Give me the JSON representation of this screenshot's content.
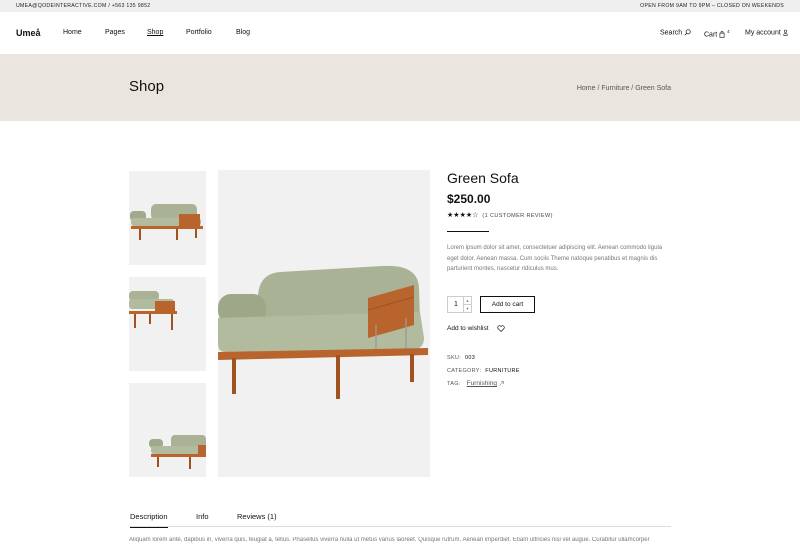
{
  "topbar": {
    "contact": "UMEA@QODEINTERACTIVE.COM / +563 135 9852",
    "hours": "OPEN FROM 9AM TO 9PM – CLOSED ON WEEKENDS"
  },
  "header": {
    "logo": "Umeå",
    "nav": [
      "Home",
      "Pages",
      "Shop",
      "Portfolio",
      "Blog"
    ],
    "active_nav": "Shop",
    "search_label": "Search",
    "cart_label": "Cart",
    "cart_count": "4",
    "account_label": "My account"
  },
  "page": {
    "title": "Shop",
    "breadcrumb": "Home / Furniture / Green Sofa"
  },
  "product": {
    "title": "Green Sofa",
    "price": "$250.00",
    "rating": 4,
    "rating_max": 5,
    "review_text": "(1 CUSTOMER REVIEW)",
    "description": "Lorem ipsum dolor sit amet, consectetuer adipiscing elit. Aenean commodo ligula eget dolor. Aenean massa. Cum sociis Theme natoque penatibus et magnis dis parturient montes, nascetur ridiculus mus.",
    "quantity": "1",
    "add_to_cart": "Add to cart",
    "wishlist": "Add to wishlist",
    "sku_label": "SKU:",
    "sku": "003",
    "category_label": "CATEGORY:",
    "category": "FURNITURE",
    "tag_label": "TAG:",
    "tag": "Furnishing"
  },
  "tabs": {
    "items": [
      "Description",
      "Info",
      "Reviews (1)"
    ],
    "active": "Description",
    "content": "Aliquam lorem ante, dapibus in, viverra quis, feugiat a, tellus. Phasellus viverra nulla ut metus varius laoreet. Quisque rutrum. Aenean imperdiet. Etiam ultricies nisi vel augue. Curabitur ullamcorper"
  },
  "colors": {
    "band": "#ebe5df",
    "sofa_green": "#a9b295",
    "wood": "#b8642c",
    "image_bg": "#f1f1f1"
  }
}
